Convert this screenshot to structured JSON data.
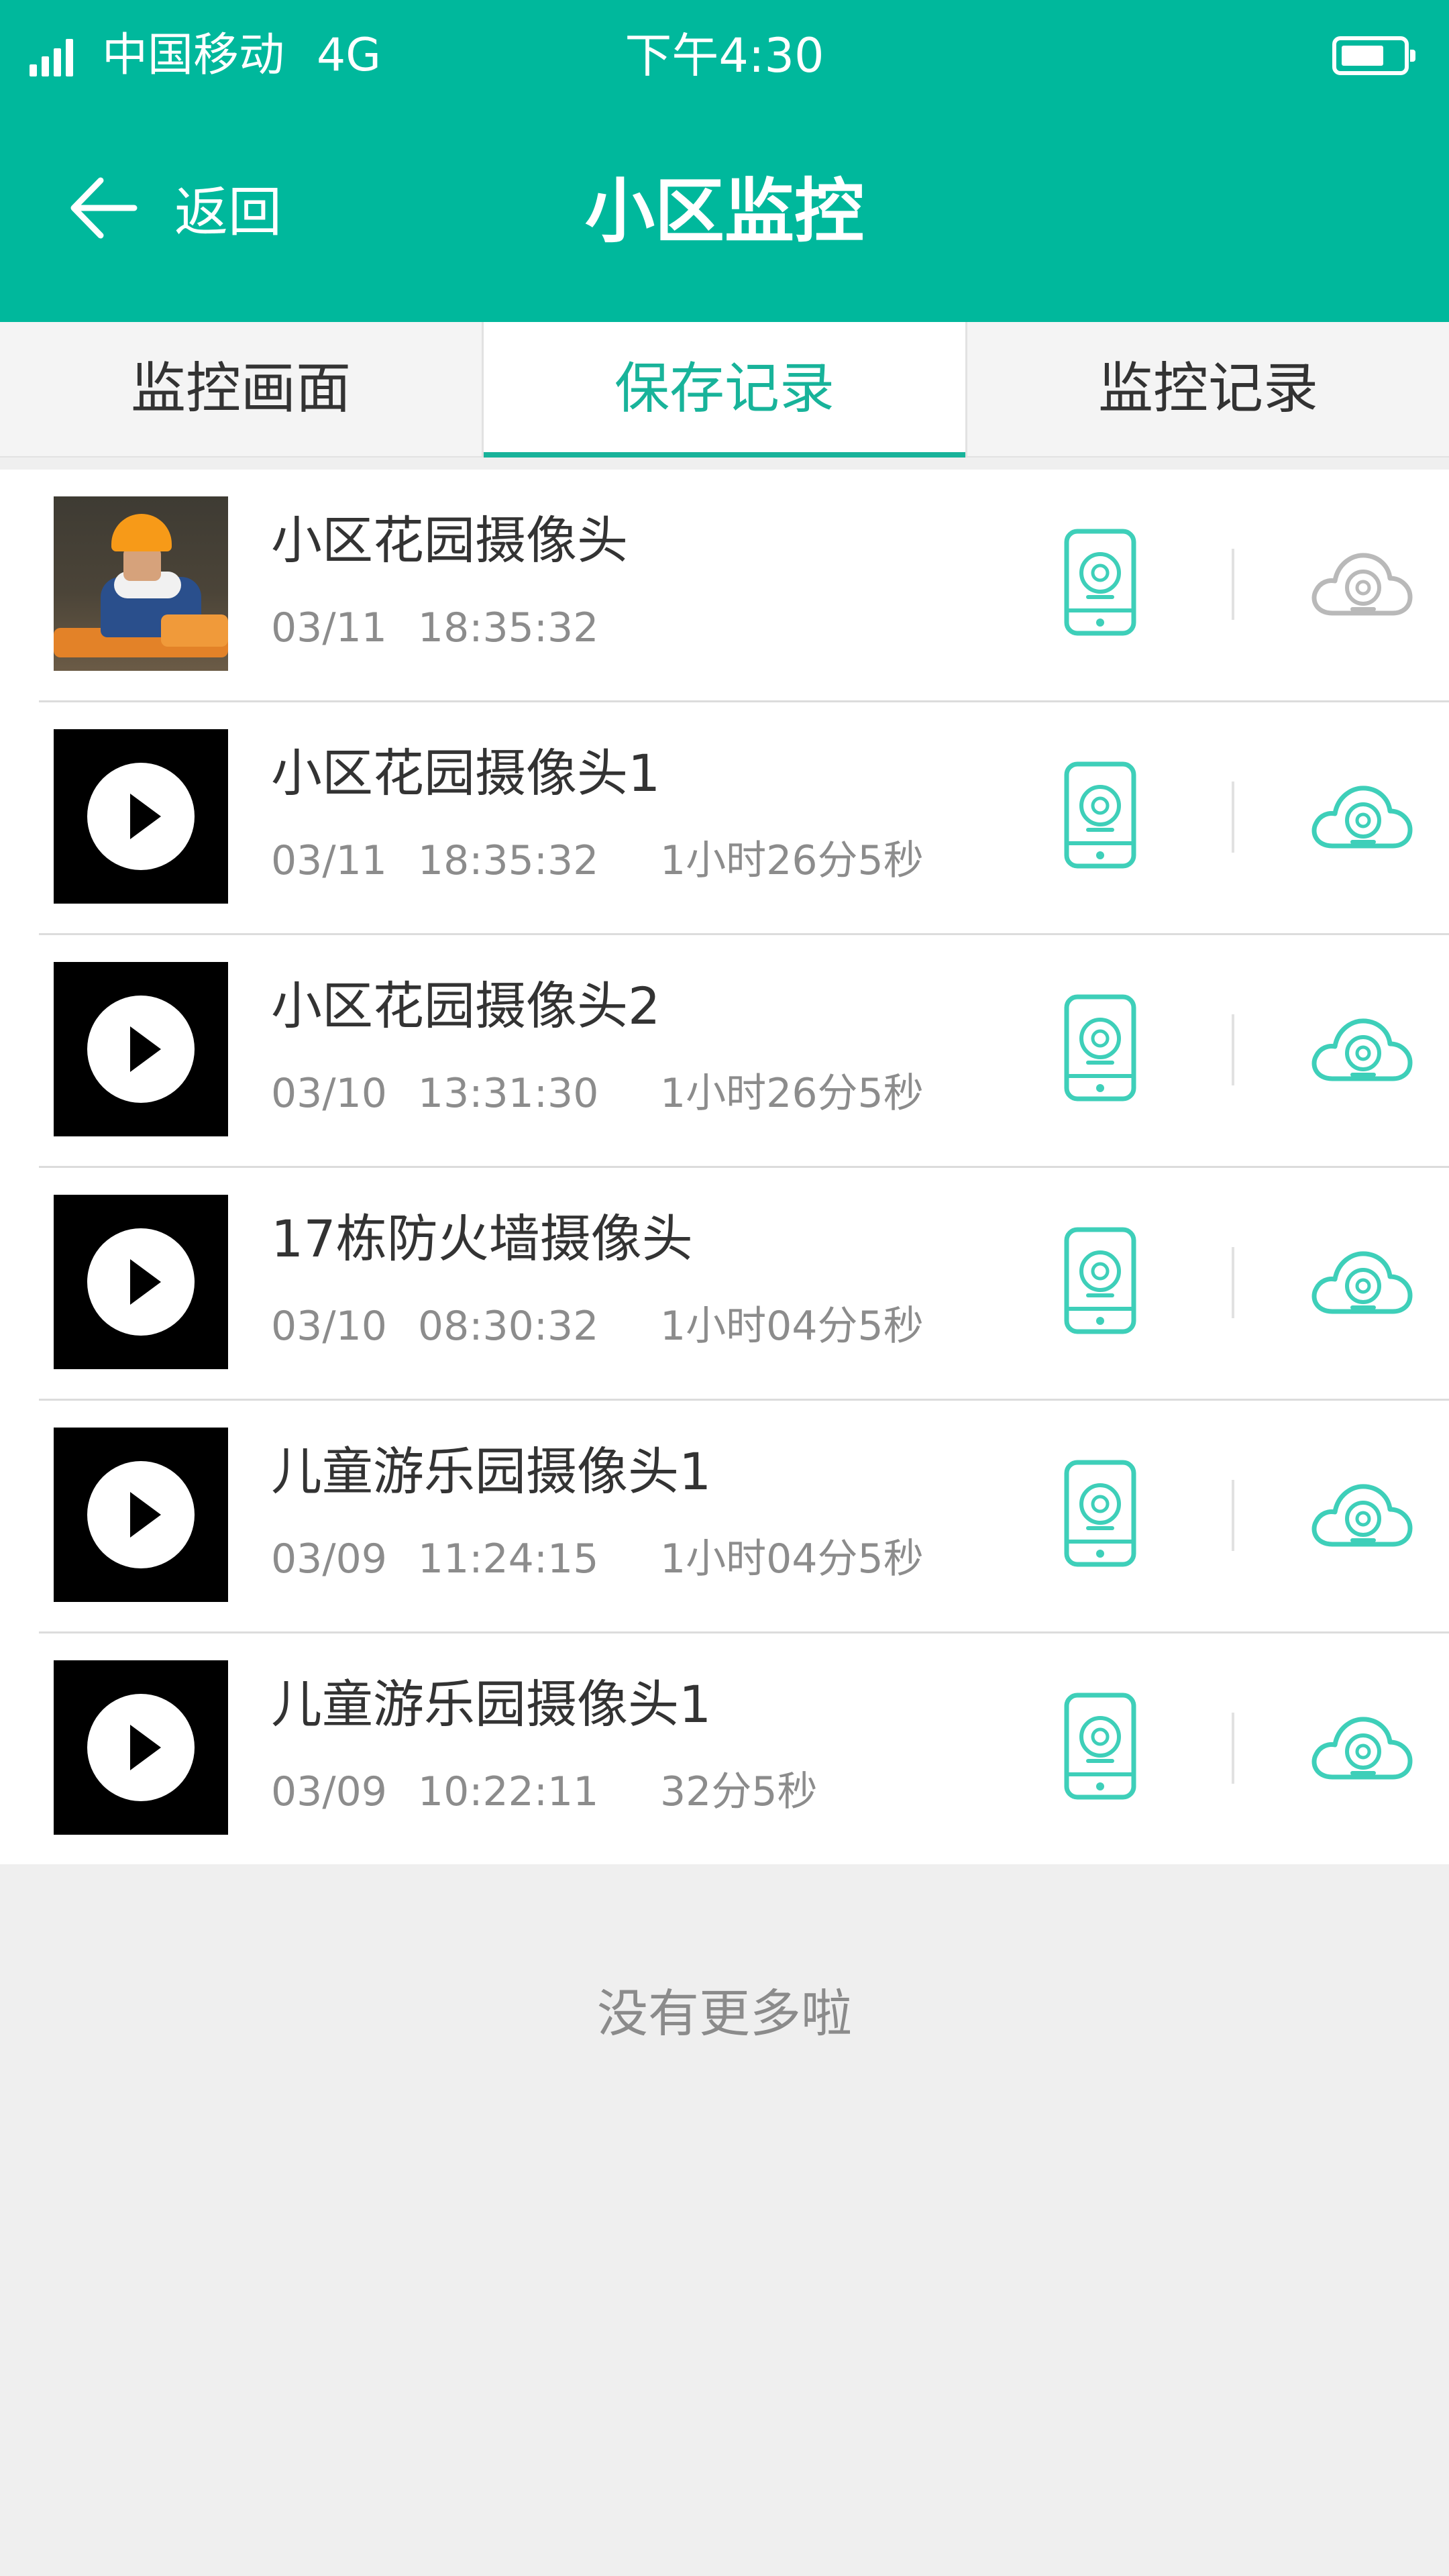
{
  "status_bar": {
    "carrier": "中国移动",
    "network": "4G",
    "time": "下午4:30"
  },
  "header": {
    "back_label": "返回",
    "title": "小区监控"
  },
  "tabs": [
    {
      "label": "监控画面",
      "active": false
    },
    {
      "label": "保存记录",
      "active": true
    },
    {
      "label": "监控记录",
      "active": false
    }
  ],
  "records": [
    {
      "name": "小区花园摄像头",
      "date": "03/11",
      "time": "18:35:32",
      "duration": "",
      "thumbnail": "photo",
      "cloud_saved": false
    },
    {
      "name": "小区花园摄像头1",
      "date": "03/11",
      "time": "18:35:32",
      "duration": "1小时26分5秒",
      "thumbnail": "video",
      "cloud_saved": true
    },
    {
      "name": "小区花园摄像头2",
      "date": "03/10",
      "time": "13:31:30",
      "duration": "1小时26分5秒",
      "thumbnail": "video",
      "cloud_saved": true
    },
    {
      "name": "17栋防火墙摄像头",
      "date": "03/10",
      "time": "08:30:32",
      "duration": "1小时04分5秒",
      "thumbnail": "video",
      "cloud_saved": true
    },
    {
      "name": "儿童游乐园摄像头1",
      "date": "03/09",
      "time": "11:24:15",
      "duration": "1小时04分5秒",
      "thumbnail": "video",
      "cloud_saved": true
    },
    {
      "name": "儿童游乐园摄像头1",
      "date": "03/09",
      "time": "10:22:11",
      "duration": "32分5秒",
      "thumbnail": "video",
      "cloud_saved": true
    }
  ],
  "footer_message": "没有更多啦",
  "colors": {
    "brand": "#00b89c",
    "accent_icon": "#3ecfb9",
    "inactive_icon": "#b9b9b9"
  }
}
